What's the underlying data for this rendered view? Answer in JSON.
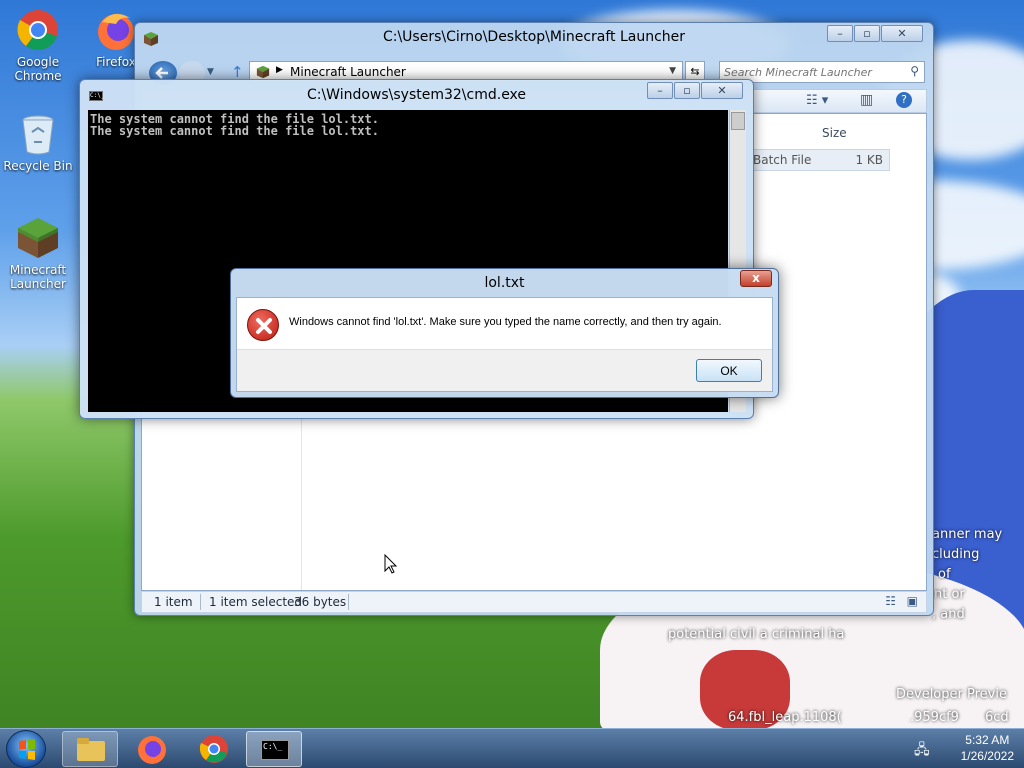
{
  "desktop": {
    "icons": [
      {
        "label": "Google Chrome",
        "icon": "chrome-icon"
      },
      {
        "label": "Firefox",
        "icon": "firefox-icon"
      },
      {
        "label": "Recycle Bin",
        "icon": "recycle-bin-icon"
      },
      {
        "label": "Minecraft Launcher",
        "icon": "minecraft-icon"
      }
    ],
    "overlay_lines": [
      "anner may",
      "cluding",
      "of",
      "nt or",
      ", and",
      "potential civil a criminal ha",
      "Developer Previe",
      "64.fbl_leap.1108(",
      ".959cf9",
      "6cd"
    ]
  },
  "explorer": {
    "title": "C:\\Users\\Cirno\\Desktop\\Minecraft Launcher",
    "breadcrumb": "Minecraft Launcher",
    "search_placeholder": "Search Minecraft Launcher",
    "column_size": "Size",
    "file_type": "Batch File",
    "file_size": "1 KB",
    "status_items": "1 item",
    "status_selected": "1 item selected",
    "status_bytes": "36 bytes"
  },
  "cmd": {
    "title": "C:\\Windows\\system32\\cmd.exe",
    "lines": [
      "The system cannot find the file lol.txt.",
      "The system cannot find the file lol.txt."
    ]
  },
  "dialog": {
    "title": "lol.txt",
    "message": "Windows cannot find 'lol.txt'. Make sure you typed the name correctly, and then try again.",
    "ok_label": "OK",
    "close_glyph": "x"
  },
  "taskbar": {
    "time": "5:32 AM",
    "date": "1/26/2022",
    "cmd_icon_text": "C:\\_"
  }
}
